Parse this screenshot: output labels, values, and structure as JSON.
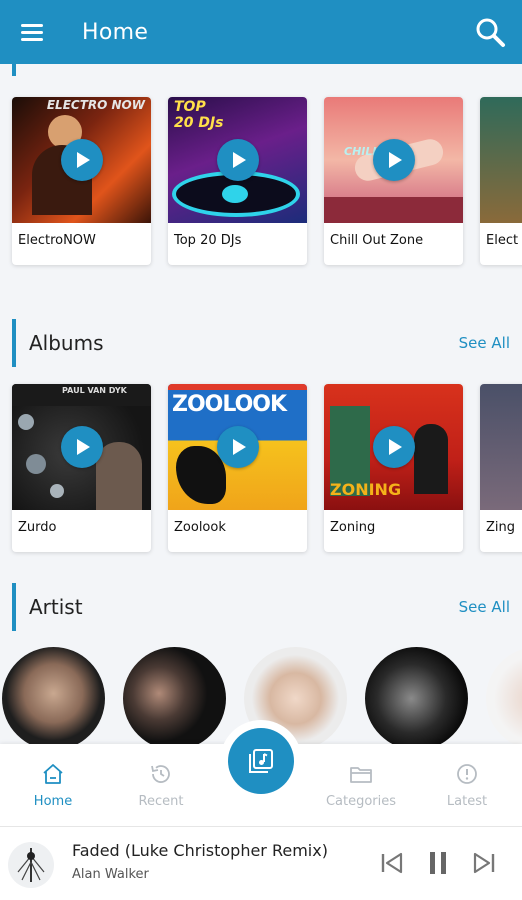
{
  "header": {
    "title": "Home"
  },
  "playlists": [
    {
      "label": "ElectroNOW",
      "art_text": "ELECTRO NOW"
    },
    {
      "label": "Top 20 DJs",
      "art_text": "TOP 20 DJs"
    },
    {
      "label": "Chill Out Zone",
      "art_text": "CHILL OUT"
    },
    {
      "label": "Elect"
    }
  ],
  "albums_section": {
    "title": "Albums",
    "see_all": "See All"
  },
  "albums": [
    {
      "label": "Zurdo",
      "art_text": "PAUL VAN DYK"
    },
    {
      "label": "Zoolook",
      "art_text": "ZOOLOOK"
    },
    {
      "label": "Zoning",
      "art_text": "ZONING"
    },
    {
      "label": "Zing"
    }
  ],
  "artist_section": {
    "title": "Artist",
    "see_all": "See All"
  },
  "nav": {
    "home": "Home",
    "recent": "Recent",
    "categories": "Categories",
    "latest": "Latest"
  },
  "player": {
    "track": "Faded (Luke Christopher Remix)",
    "artist": "Alan Walker"
  },
  "colors": {
    "accent": "#1f8fc2",
    "inactive": "#b6bcc2"
  }
}
